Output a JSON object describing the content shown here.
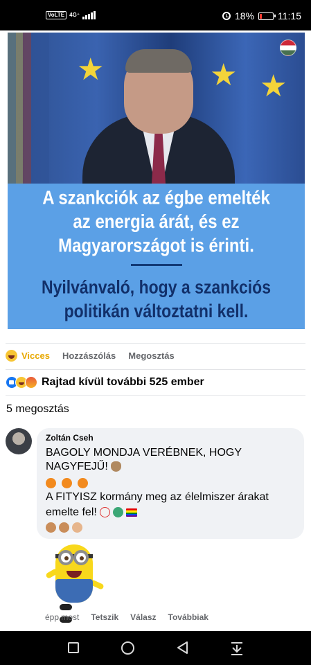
{
  "status_bar": {
    "volte": "VoLTE",
    "network": "4G⁺",
    "battery": "18%",
    "time": "11:15"
  },
  "post_image": {
    "headline_lines": [
      "A szankciók az égbe emelték",
      "az energia árát, és ez",
      "Magyarországot is érinti."
    ],
    "subline_lines": [
      "Nyilvánvaló, hogy a szankciós",
      "politikán változtatni kell."
    ],
    "flag_icon": "hungary-flag-icon"
  },
  "actions": {
    "reaction": "Vicces",
    "comment": "Hozzászólás",
    "share": "Megosztás"
  },
  "reactions_summary": "Rajtad kívül további 525 ember",
  "shares_count": "5 megosztás",
  "comment": {
    "author": "Zoltán Cseh",
    "line1": "BAGOLY MONDJA VERÉBNEK, HOGY",
    "line2": "NAGYFEJŰ!",
    "line3": "A FITYISZ kormány meg az élelmiszer árakat",
    "line4": "emelte fel!",
    "time": "épp most",
    "like": "Tetszik",
    "reply": "Válasz",
    "more": "Továbbiak"
  }
}
